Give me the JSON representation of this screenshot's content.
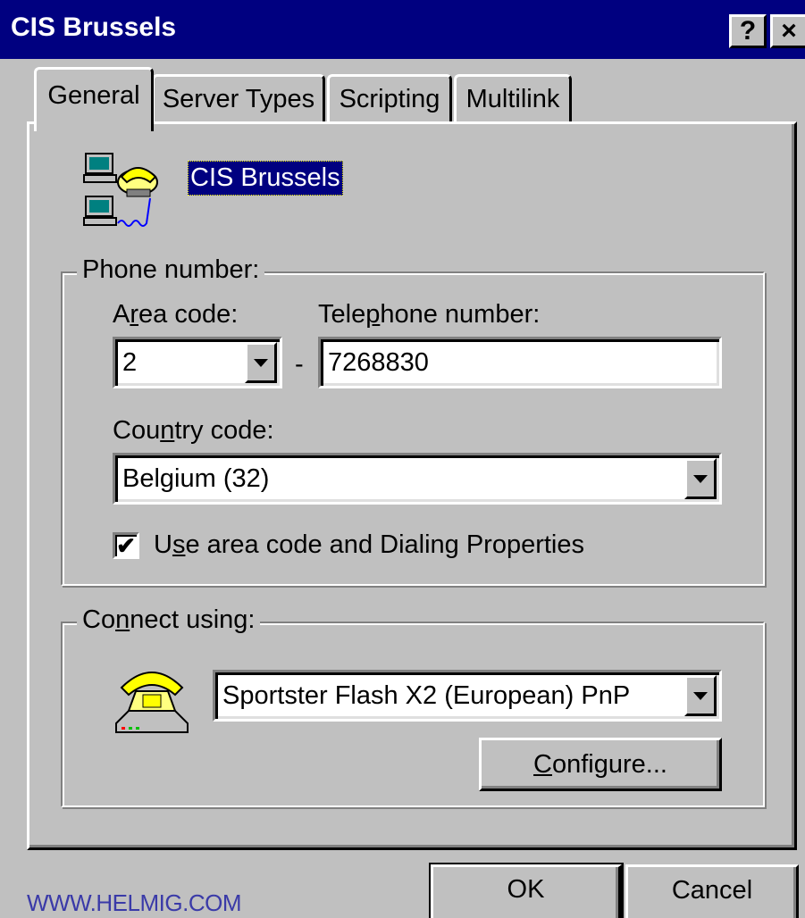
{
  "window": {
    "title": "CIS Brussels",
    "help_button": "?",
    "close_button": "×"
  },
  "tabs": [
    {
      "label": "General",
      "active": true
    },
    {
      "label": "Server Types",
      "active": false
    },
    {
      "label": "Scripting",
      "active": false
    },
    {
      "label": "Multilink",
      "active": false
    }
  ],
  "general": {
    "entry_name": "CIS Brussels",
    "phone_group": {
      "legend": "Phone number:",
      "area_code_label_pre": "A",
      "area_code_label_mnemonic": "r",
      "area_code_label_post": "ea code:",
      "area_code_value": "2",
      "separator": "-",
      "telephone_label_pre": "Tele",
      "telephone_label_mnemonic": "p",
      "telephone_label_post": "hone number:",
      "telephone_value": "7268830",
      "country_label_pre": "Cou",
      "country_label_mnemonic": "n",
      "country_label_post": "try code:",
      "country_value": "Belgium (32)",
      "use_area_code_pre": "U",
      "use_area_code_mnemonic": "s",
      "use_area_code_post": "e area code and Dialing Properties",
      "use_area_code_checked": true
    },
    "connect_group": {
      "legend_pre": "Co",
      "legend_mnemonic": "n",
      "legend_post": "nect using:",
      "modem_value": "Sportster Flash X2 (European) PnP",
      "configure_mnemonic": "C",
      "configure_post": "onfigure..."
    }
  },
  "footer": {
    "ok_label": "OK",
    "cancel_label": "Cancel",
    "watermark": "WWW.HELMIG.COM"
  },
  "icons": {
    "connection": "dial-up-connection-icon",
    "modem": "telephone-modem-icon"
  },
  "colors": {
    "titlebar": "#000080",
    "face": "#c0c0c0",
    "selection": "#000080"
  }
}
